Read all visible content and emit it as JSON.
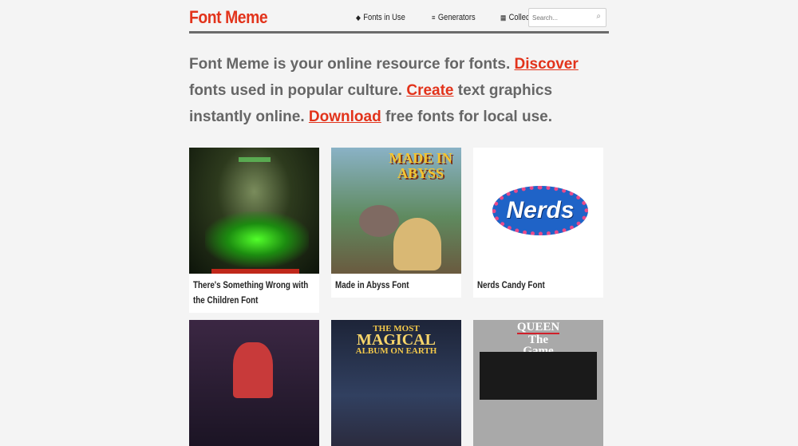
{
  "header": {
    "logo": "Font Meme",
    "nav": [
      {
        "icon": "tag-icon",
        "glyph": "◆",
        "label": "Fonts in Use"
      },
      {
        "icon": "generators-icon",
        "glyph": "≡",
        "label": "Generators"
      },
      {
        "icon": "grid-icon",
        "glyph": "▦",
        "label": "Collection"
      }
    ],
    "search_placeholder": "Search...",
    "search_icon": "⌕"
  },
  "intro": {
    "t1": "Font Meme is your online resource for fonts. ",
    "link1": "Discover",
    "t2": " fonts used in popular culture. ",
    "link2": "Create",
    "t3": " text graphics instantly online. ",
    "link3": "Download",
    "t4": " free fonts for local use."
  },
  "cards": [
    {
      "caption": "There's Something Wrong with the Children Font"
    },
    {
      "caption": "Made in Abyss Font",
      "art_text": "MADE IN ABYSS"
    },
    {
      "caption": "Nerds Candy Font",
      "art_text": "Nerds"
    }
  ],
  "row2": {
    "card5_line1": "THE MOST",
    "card5_line2": "MAGICAL",
    "card5_line3": "ALBUM ON EARTH",
    "card6_line1": "QUEEN",
    "card6_line2": "The",
    "card6_line3": "Game"
  },
  "colors": {
    "accent": "#e2331b",
    "text": "#666666",
    "background": "#f4f4f4"
  }
}
